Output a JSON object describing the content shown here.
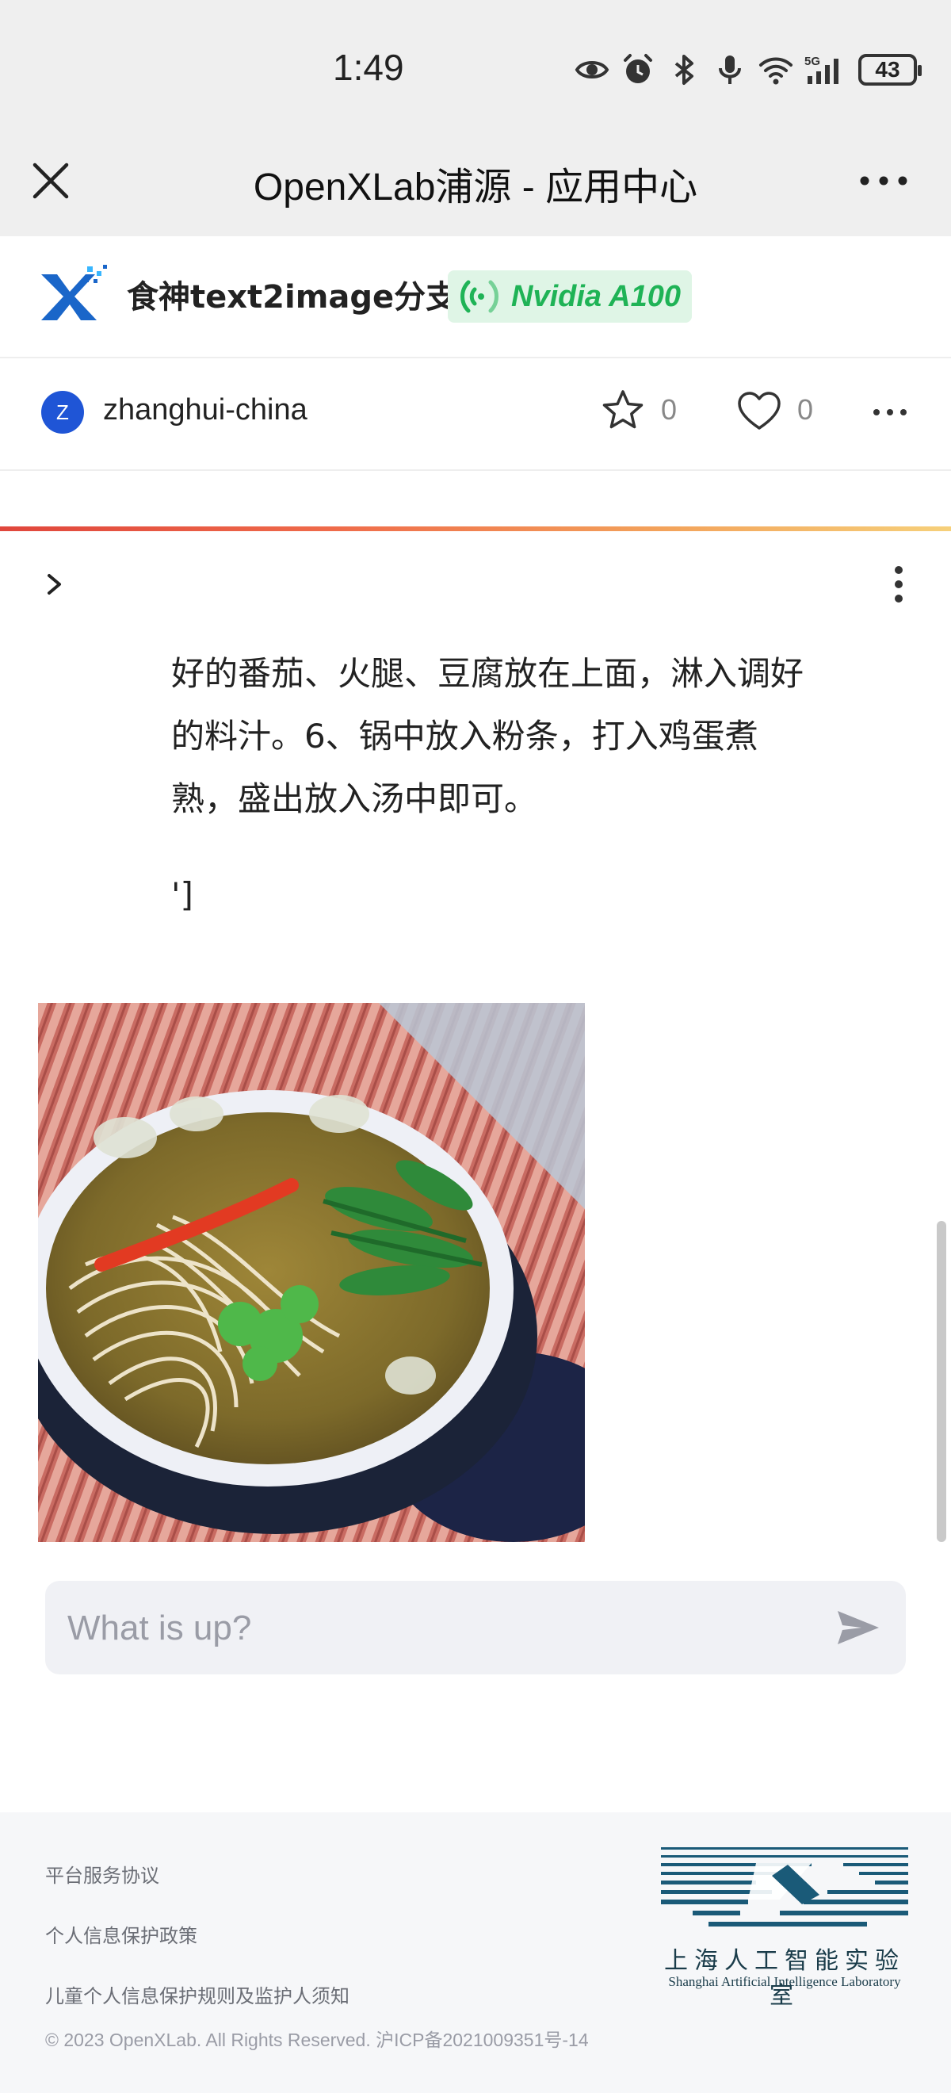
{
  "status_bar": {
    "time": "1:49",
    "battery": "43",
    "icons": [
      "eye-icon",
      "alarm-icon",
      "bluetooth-icon",
      "microphone-icon",
      "wifi-icon",
      "signal-5g-icon",
      "battery-icon"
    ]
  },
  "title_bar": {
    "title": "OpenXLab浦源 - 应用中心"
  },
  "app": {
    "name": "食神text2image分支",
    "gpu": "Nvidia A100",
    "author_initial": "Z",
    "author": "zhanghui-china",
    "stars": "0",
    "likes": "0"
  },
  "chat": {
    "lines": [
      "好的番茄、火腿、豆腐放在上面，淋入调好",
      "的料汁。6、锅中放入粉条，打入鸡蛋煮",
      "熟，盛出放入汤中即可。"
    ],
    "tail": "']",
    "image_subject": "bowl of noodle soup with greens and cilantro"
  },
  "input": {
    "placeholder": "What is up?"
  },
  "footer": {
    "links": [
      "平台服务协议",
      "个人信息保护政策",
      "儿童个人信息保护规则及监护人须知"
    ],
    "copyright": "© 2023 OpenXLab. All Rights Reserved. 沪ICP备2021009351号-14",
    "lab_name_cn": "上海人工智能实验室",
    "lab_name_en": "Shanghai Artificial Intelligence Laboratory"
  },
  "colors": {
    "accent_green": "#1fb356",
    "avatar_blue": "#1f55d6",
    "logo_blue": "#1a66c9",
    "lab_teal": "#1a5a78"
  }
}
